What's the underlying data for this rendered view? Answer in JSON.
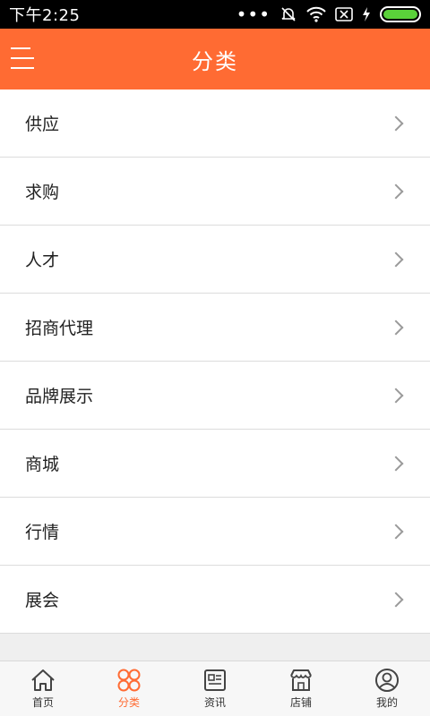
{
  "status_bar": {
    "time": "下午2:25",
    "dots": "•••"
  },
  "header": {
    "title": "分类"
  },
  "list": {
    "items": [
      {
        "label": "供应"
      },
      {
        "label": "求购"
      },
      {
        "label": "人才"
      },
      {
        "label": "招商代理"
      },
      {
        "label": "品牌展示"
      },
      {
        "label": "商城"
      },
      {
        "label": "行情"
      },
      {
        "label": "展会"
      }
    ]
  },
  "tabbar": {
    "accent_color": "#ff6b33",
    "tabs": [
      {
        "label": "首页",
        "icon": "home-icon"
      },
      {
        "label": "分类",
        "icon": "category-icon",
        "active": true
      },
      {
        "label": "资讯",
        "icon": "news-icon"
      },
      {
        "label": "店铺",
        "icon": "store-icon"
      },
      {
        "label": "我的",
        "icon": "user-icon"
      }
    ]
  }
}
